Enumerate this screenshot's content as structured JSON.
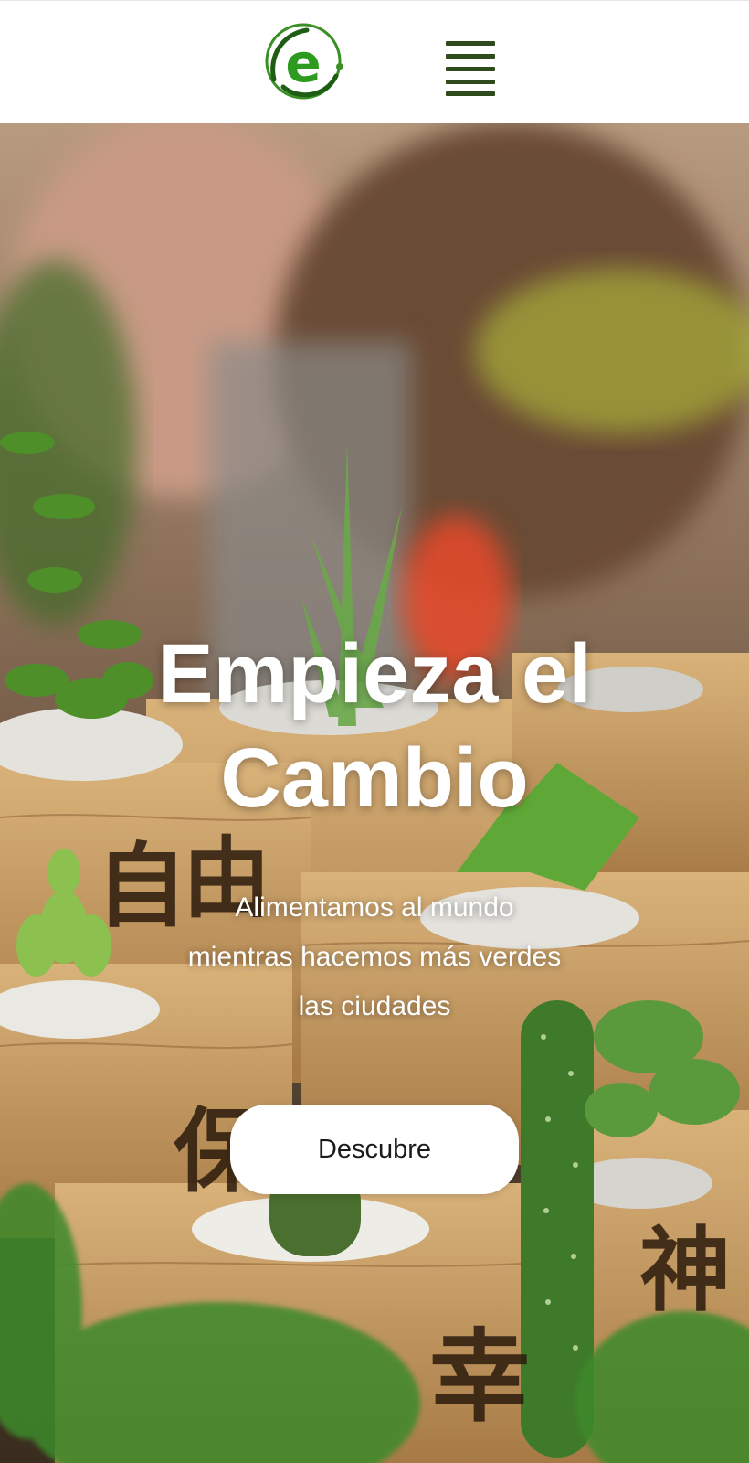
{
  "header": {
    "logo_letter": "e",
    "logo_icon": "leaf-e-logo-icon",
    "menu_icon": "hamburger-menu-icon"
  },
  "hero": {
    "title_line1": "Empieza el",
    "title_line2": "Cambio",
    "subtitle_line1": "Alimentamos al mundo",
    "subtitle_line2": "mientras hacemos más verdes",
    "subtitle_line3": "las ciudades",
    "cta_label": "Descubre",
    "background_image": "succulents-in-wooden-pots-photo",
    "pot_glyphs": [
      "自",
      "由",
      "保",
      "幸",
      "神"
    ]
  },
  "colors": {
    "brand_green": "#2e8b1e",
    "menu_dark_green": "#2f4a1d",
    "header_bg": "#ffffff",
    "button_bg": "#ffffff",
    "hero_text": "#ffffff"
  }
}
